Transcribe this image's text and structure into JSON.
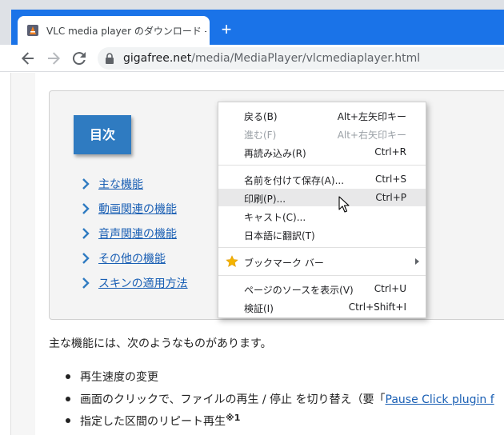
{
  "tab": {
    "title": "VLC media player のダウンロード - ｜",
    "favicon": "vlc-favicon-icon"
  },
  "new_tab": "+",
  "toolbar": {
    "back": "back-arrow-icon",
    "forward": "forward-arrow-icon",
    "reload": "reload-icon",
    "url_domain": "gigafree.net",
    "url_path": "/media/MediaPlayer/vlcmediaplayer.html"
  },
  "toc": {
    "header": "目次",
    "items": [
      {
        "label": "主な機能"
      },
      {
        "label": "動画関連の機能"
      },
      {
        "label": "音声関連の機能"
      },
      {
        "label": "その他の機能"
      },
      {
        "label": "スキンの適用方法"
      }
    ]
  },
  "content": {
    "intro": "主な機能には、次のようなものがあります。",
    "bullets": [
      {
        "text": "再生速度の変更"
      },
      {
        "text": "画面のクリックで、ファイルの再生 / 停止 を切り替え（要「",
        "link": "Pause Click plugin f"
      },
      {
        "text": "指定した区間のリピート再生",
        "sup": "※1"
      }
    ]
  },
  "context_menu": {
    "items": [
      {
        "label": "戻る(B)",
        "shortcut": "Alt+左矢印キー",
        "disabled": false
      },
      {
        "label": "進む(F)",
        "shortcut": "Alt+右矢印キー",
        "disabled": true
      },
      {
        "label": "再読み込み(R)",
        "shortcut": "Ctrl+R",
        "disabled": false
      },
      {
        "label": "名前を付けて保存(A)...",
        "shortcut": "Ctrl+S",
        "disabled": false
      },
      {
        "label": "印刷(P)...",
        "shortcut": "Ctrl+P",
        "disabled": false,
        "hover": true
      },
      {
        "label": "キャスト(C)...",
        "shortcut": "",
        "disabled": false
      },
      {
        "label": "日本語に翻訳(T)",
        "shortcut": "",
        "disabled": false
      },
      {
        "label": "ブックマーク バー",
        "shortcut": "",
        "icon": "star-icon",
        "submenu": true
      },
      {
        "label": "ページのソースを表示(V)",
        "shortcut": "Ctrl+U",
        "disabled": false
      },
      {
        "label": "検証(I)",
        "shortcut": "Ctrl+Shift+I",
        "disabled": false
      }
    ]
  },
  "colors": {
    "chrome_accent": "#1a73e8",
    "toc_header_bg": "#2f7bc1",
    "link": "#1a5fb4",
    "star": "#f4b400"
  }
}
